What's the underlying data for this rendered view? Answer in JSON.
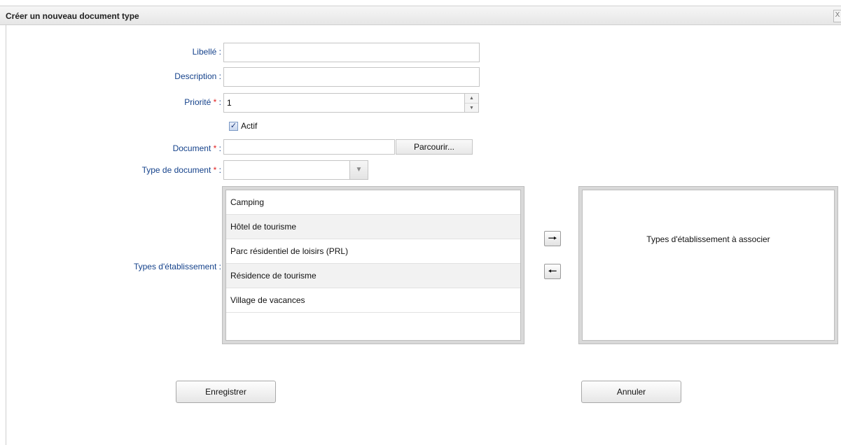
{
  "dialog": {
    "title": "Créer un nouveau document type",
    "close_glyph": "X"
  },
  "form": {
    "libelle_label": "Libellé",
    "libelle_value": "",
    "description_label": "Description",
    "description_value": "",
    "priorite_label": "Priorité",
    "priorite_value": "1",
    "actif_label": "Actif",
    "actif_checked": true,
    "document_label": "Document",
    "document_value": "",
    "browse_label": "Parcourir...",
    "type_doc_label": "Type de document",
    "type_doc_value": "",
    "etab_label": "Types d'établissement",
    "required_mark": "*",
    "colon": ":"
  },
  "available_list": {
    "items": [
      "Camping",
      "Hôtel de tourisme",
      "Parc résidentiel de loisirs (PRL)",
      "Résidence de tourisme",
      "Village de vacances"
    ]
  },
  "selected_list": {
    "empty_text": "Types d'établissement à associer"
  },
  "arrows": {
    "add_glyph": "🠒",
    "remove_glyph": "🠐"
  },
  "actions": {
    "save_label": "Enregistrer",
    "cancel_label": "Annuler"
  }
}
